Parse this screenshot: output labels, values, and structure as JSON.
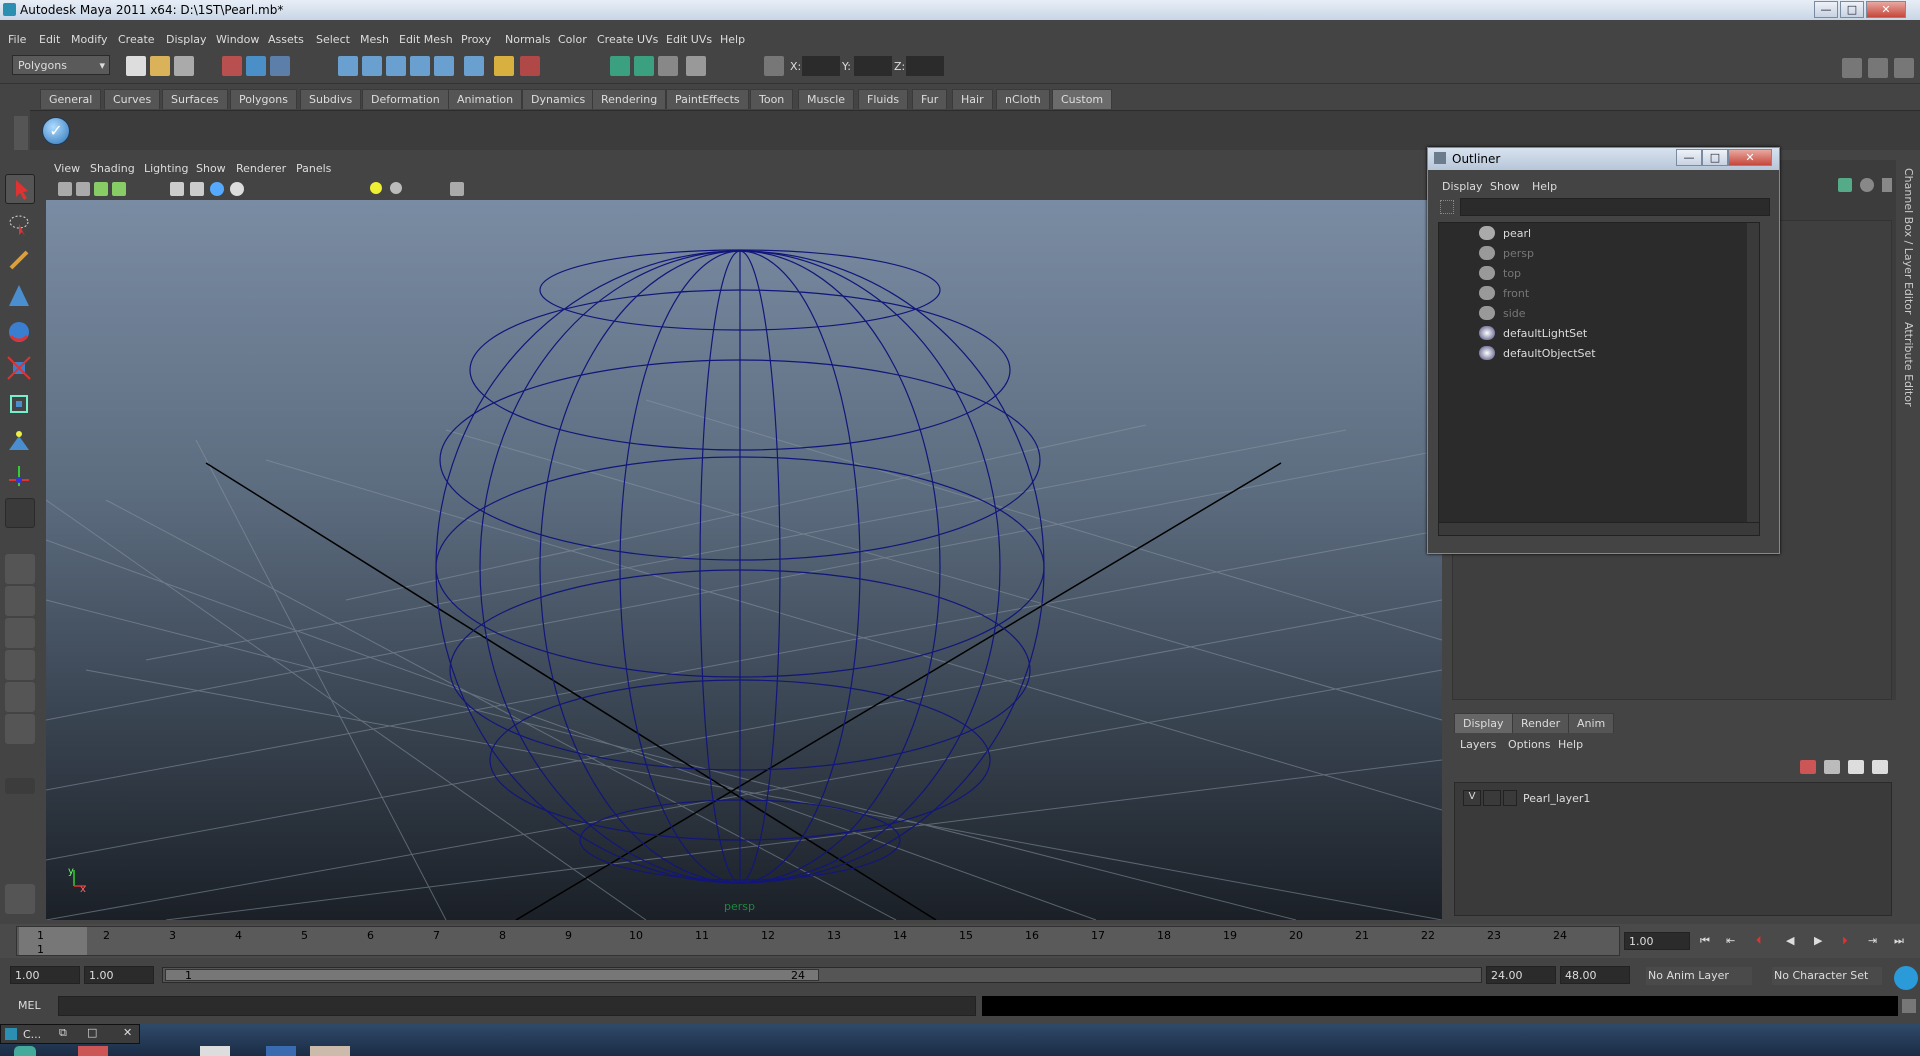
{
  "window": {
    "title": "Autodesk Maya 2011 x64: D:\\1ST\\Pearl.mb*",
    "min": "—",
    "max": "□",
    "close": "✕"
  },
  "menubar": [
    "File",
    "Edit",
    "Modify",
    "Create",
    "Display",
    "Window",
    "Assets",
    "Select",
    "Mesh",
    "Edit Mesh",
    "Proxy",
    "Normals",
    "Color",
    "Create UVs",
    "Edit UVs",
    "Help"
  ],
  "status": {
    "mode": "Polygons",
    "x_label": "X:",
    "y_label": "Y:",
    "z_label": "Z:"
  },
  "shelf_tabs": [
    "General",
    "Curves",
    "Surfaces",
    "Polygons",
    "Subdivs",
    "Deformation",
    "Animation",
    "Dynamics",
    "Rendering",
    "PaintEffects",
    "Toon",
    "Muscle",
    "Fluids",
    "Fur",
    "Hair",
    "nCloth",
    "Custom"
  ],
  "shelf_active": "Custom",
  "viewport_menu": [
    "View",
    "Shading",
    "Lighting",
    "Show",
    "Renderer",
    "Panels"
  ],
  "viewport": {
    "camera_label": "persp",
    "axis_y": "y",
    "axis_x": "x"
  },
  "outliner": {
    "title": "Outliner",
    "menu": [
      "Display",
      "Show",
      "Help"
    ],
    "items": [
      {
        "label": "pearl",
        "dim": false
      },
      {
        "label": "persp",
        "dim": true
      },
      {
        "label": "top",
        "dim": true
      },
      {
        "label": "front",
        "dim": true
      },
      {
        "label": "side",
        "dim": true
      },
      {
        "label": "defaultLightSet",
        "dim": false
      },
      {
        "label": "defaultObjectSet",
        "dim": false
      }
    ]
  },
  "side_tabs": [
    "Channel Box / Layer Editor",
    "Attribute Editor"
  ],
  "layer_editor": {
    "tabs": [
      "Display",
      "Render",
      "Anim"
    ],
    "menu": [
      "Layers",
      "Options",
      "Help"
    ],
    "layer": {
      "visible": "V",
      "name": "Pearl_layer1"
    }
  },
  "timeline": {
    "ticks": [
      "1",
      "2",
      "3",
      "4",
      "5",
      "6",
      "7",
      "8",
      "9",
      "10",
      "11",
      "12",
      "13",
      "14",
      "15",
      "16",
      "17",
      "18",
      "19",
      "20",
      "21",
      "22",
      "23",
      "24"
    ],
    "current_frame": "1",
    "current_field": "1.00"
  },
  "range": {
    "start": "1.00",
    "playback_start": "1.00",
    "slider_start": "1",
    "slider_end": "24",
    "playback_end": "24.00",
    "end": "48.00",
    "anim_layer": "No Anim Layer",
    "char_set": "No Character Set"
  },
  "cmdline": {
    "label": "MEL"
  },
  "taskbar": {
    "maya_item": "C..."
  }
}
